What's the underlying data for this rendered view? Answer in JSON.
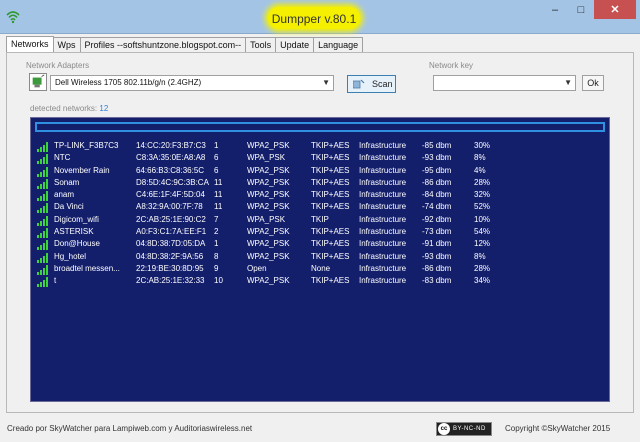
{
  "window": {
    "title": "Dumpper v.80.1"
  },
  "tabs": [
    {
      "label": "Networks",
      "active": true
    },
    {
      "label": "Wps"
    },
    {
      "label": "Profiles --softshuntzone.blogspot.com--"
    },
    {
      "label": "Tools"
    },
    {
      "label": "Update"
    },
    {
      "label": "Language"
    }
  ],
  "adapters": {
    "label": "Network Adapters",
    "selected": "Dell Wireless 1705 802.11b/g/n (2.4GHZ)",
    "scan_label": "Scan"
  },
  "network_key": {
    "label": "Network key",
    "value": "",
    "ok_label": "Ok"
  },
  "detected": {
    "label": "detected networks:",
    "count": "12"
  },
  "networks": [
    {
      "ssid": "TP-LINK_F3B7C3",
      "mac": "14:CC:20:F3:B7:C3",
      "channel": "1",
      "security": "WPA2_PSK",
      "cipher": "TKIP+AES",
      "mode": "Infrastructure",
      "dbm": "-85 dbm",
      "signal": "30%"
    },
    {
      "ssid": "NTC",
      "mac": "C8:3A:35:0E:A8:A8",
      "channel": "6",
      "security": "WPA_PSK",
      "cipher": "TKIP+AES",
      "mode": "Infrastructure",
      "dbm": "-93 dbm",
      "signal": "8%"
    },
    {
      "ssid": "November Rain",
      "mac": "64:66:B3:C8:36:5C",
      "channel": "6",
      "security": "WPA2_PSK",
      "cipher": "TKIP+AES",
      "mode": "Infrastructure",
      "dbm": "-95 dbm",
      "signal": "4%"
    },
    {
      "ssid": "Sonam",
      "mac": "D8:5D:4C:9C:3B:CA",
      "channel": "11",
      "security": "WPA2_PSK",
      "cipher": "TKIP+AES",
      "mode": "Infrastructure",
      "dbm": "-86 dbm",
      "signal": "28%"
    },
    {
      "ssid": "anam",
      "mac": "C4:6E:1F:4F:5D:04",
      "channel": "11",
      "security": "WPA2_PSK",
      "cipher": "TKIP+AES",
      "mode": "Infrastructure",
      "dbm": "-84 dbm",
      "signal": "32%"
    },
    {
      "ssid": "Da Vinci",
      "mac": "A8:32:9A:00:7F:78",
      "channel": "11",
      "security": "WPA2_PSK",
      "cipher": "TKIP+AES",
      "mode": "Infrastructure",
      "dbm": "-74 dbm",
      "signal": "52%"
    },
    {
      "ssid": "Digicom_wifi",
      "mac": "2C:AB:25:1E:90:C2",
      "channel": "7",
      "security": "WPA_PSK",
      "cipher": "TKIP",
      "mode": "Infrastructure",
      "dbm": "-92 dbm",
      "signal": "10%"
    },
    {
      "ssid": "ASTERISK",
      "mac": "A0:F3:C1:7A:EE:F1",
      "channel": "2",
      "security": "WPA2_PSK",
      "cipher": "TKIP+AES",
      "mode": "Infrastructure",
      "dbm": "-73 dbm",
      "signal": "54%"
    },
    {
      "ssid": "Don@House",
      "mac": "04:8D:38:7D:05:DA",
      "channel": "1",
      "security": "WPA2_PSK",
      "cipher": "TKIP+AES",
      "mode": "Infrastructure",
      "dbm": "-91 dbm",
      "signal": "12%"
    },
    {
      "ssid": "Hg_hotel",
      "mac": "04:8D:38:2F:9A:56",
      "channel": "8",
      "security": "WPA2_PSK",
      "cipher": "TKIP+AES",
      "mode": "Infrastructure",
      "dbm": "-93 dbm",
      "signal": "8%"
    },
    {
      "ssid": "broadtel messen...",
      "mac": "22:19:BE:30:8D:95",
      "channel": "9",
      "security": "Open",
      "cipher": "None",
      "mode": "Infrastructure",
      "dbm": "-86 dbm",
      "signal": "28%"
    },
    {
      "ssid": "t",
      "mac": "2C:AB:25:1E:32:33",
      "channel": "10",
      "security": "WPA2_PSK",
      "cipher": "TKIP+AES",
      "mode": "Infrastructure",
      "dbm": "-83 dbm",
      "signal": "34%"
    }
  ],
  "footer": {
    "credit": "Creado por SkyWatcher para Lampiweb.com y Auditoriaswireless.net",
    "license_circle": "cc",
    "license_text": "BY-NC-ND",
    "copyright": "Copyright ©SkyWatcher 2015"
  },
  "colors": {
    "list_background": "#141f6c",
    "signal_bar": "#3fd23f",
    "title_highlight": "#f5f000"
  }
}
